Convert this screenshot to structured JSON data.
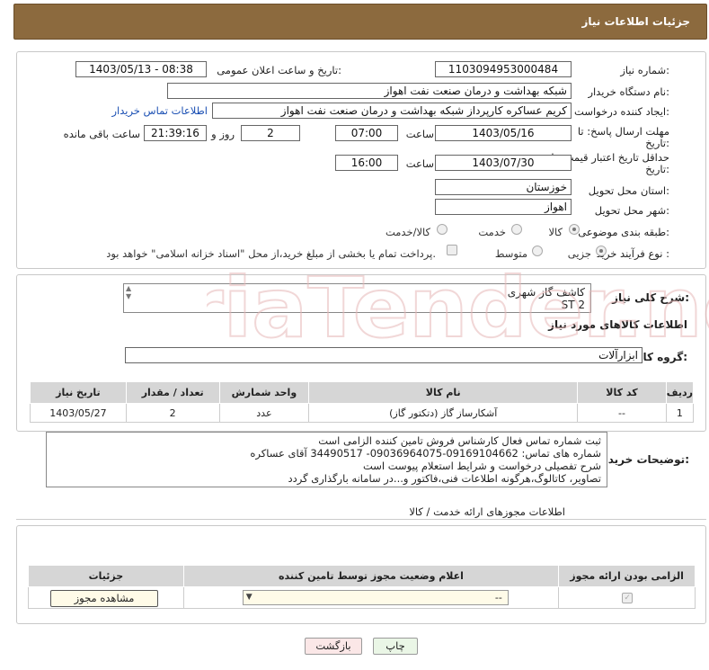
{
  "header": {
    "title": "جزئیات اطلاعات نیاز"
  },
  "form": {
    "need_number_label": "شماره نیاز:",
    "need_number": "1103094953000484",
    "announce_label": "تاریخ و ساعت اعلان عمومی:",
    "announce_value": "1403/05/13 - 08:38",
    "buyer_org_label": "نام دستگاه خریدار:",
    "buyer_org": "شبکه بهداشت و درمان صنعت نفت اهواز",
    "creator_label": "ایجاد کننده درخواست:",
    "creator": "کریم عساکره کارپرداز شبکه بهداشت و درمان صنعت نفت اهواز",
    "contact_link": "اطلاعات تماس خریدار",
    "deadline_label_1": "مهلت ارسال پاسخ: تا",
    "deadline_label_2": "تاریخ:",
    "deadline_date": "1403/05/16",
    "time_label": "ساعت",
    "deadline_time": "07:00",
    "days_value": "2",
    "days_label": "روز و",
    "remaining_time": "21:39:16",
    "remaining_label": "ساعت باقی مانده",
    "validity_label_1": "حداقل تاریخ اعتبار قیمت: تا",
    "validity_label_2": "تاریخ:",
    "validity_date": "1403/07/30",
    "validity_time": "16:00",
    "province_label": "استان محل تحویل:",
    "province": "خوزستان",
    "city_label": "شهر محل تحویل:",
    "city": "اهواز",
    "category_label": "طبقه بندی موضوعی:",
    "category_options": [
      "کالا",
      "خدمت",
      "کالا/خدمت"
    ],
    "process_label": "نوع فرآیند خرید :",
    "process_options": [
      "جزیی",
      "متوسط"
    ],
    "payment_note": "پرداخت تمام یا بخشی از مبلغ خرید،از محل \"اسناد خزانه اسلامی\" خواهد بود."
  },
  "summary": {
    "label": "شرح کلی نیاز:",
    "lines": [
      "کاشف گاز شهری",
      "ST 2"
    ],
    "goods_info_title": "اطلاعات کالاهای مورد نیاز",
    "goods_group_label": "گروه کالا:",
    "goods_group": "ابزارآلات"
  },
  "items_table": {
    "headers": [
      "ردیف",
      "کد کالا",
      "نام کالا",
      "واحد شمارش",
      "تعداد / مقدار",
      "تاریخ نیاز"
    ],
    "rows": [
      [
        "1",
        "--",
        "آشکارساز گاز (دتکتور گاز)",
        "عدد",
        "2",
        "1403/05/27"
      ]
    ]
  },
  "buyer_notes": {
    "label": "توضیحات خریدار:",
    "lines": [
      "ثبت شماره تماس فعال کارشناس فروش تامین کننده الزامی است",
      "شماره های تماس: 09169104662-09036964075- 34490517 آقای عساکره",
      "شرح تفصیلی درخواست و شرایط استعلام پیوست است",
      "تصاویر، کاتالوگ،هرگونه اطلاعات فنی،فاکتور و...در سامانه بارگذاری گردد"
    ]
  },
  "permits": {
    "title": "اطلاعات مجوزهای ارائه خدمت / کالا",
    "headers": [
      "الزامی بودن ارائه مجوز",
      "اعلام وضعیت مجوز توسط تامین کننده",
      "جزئیات"
    ],
    "select_value": "--",
    "view_button": "مشاهده مجوز"
  },
  "footer": {
    "print_button": "چاپ",
    "back_button": "بازگشت"
  },
  "watermark": {
    "text": "AriaTender.net"
  }
}
